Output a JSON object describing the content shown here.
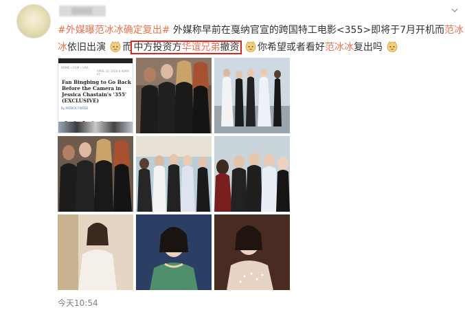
{
  "post": {
    "topic1": "#外媒曝范冰冰确定复出#",
    "t1": " 外媒称早前在戛纳官宣的跨国特工电影<355>即将于7月开机而",
    "link1a": "范冰",
    "link1b": "冰",
    "t2": "依旧出演",
    "t3": "而",
    "boxed_plain": "中方投资方",
    "boxed_link": "华谊兄弟",
    "boxed_plain2": "撤资",
    "t4": "你希望或者看好",
    "link2": "范冰冰",
    "t5": "复出吗",
    "timestamp": "今天10:54"
  },
  "article": {
    "nav": "HOME » FILM » USA",
    "date": "APRIL 10, 2019 8:40AM PT",
    "headline": "Fan Bingbing to Go Back Before the Camera in Jessica Chastain's '355' (EXCLUSIVE)",
    "byline": "By PATRICK FRATER"
  },
  "colors": {
    "topic": "#eb7350",
    "highlight_box": "#e2231a",
    "timestamp": "#808080"
  },
  "icons": [
    "chevron-down-icon",
    "doge-emoji-icon"
  ]
}
